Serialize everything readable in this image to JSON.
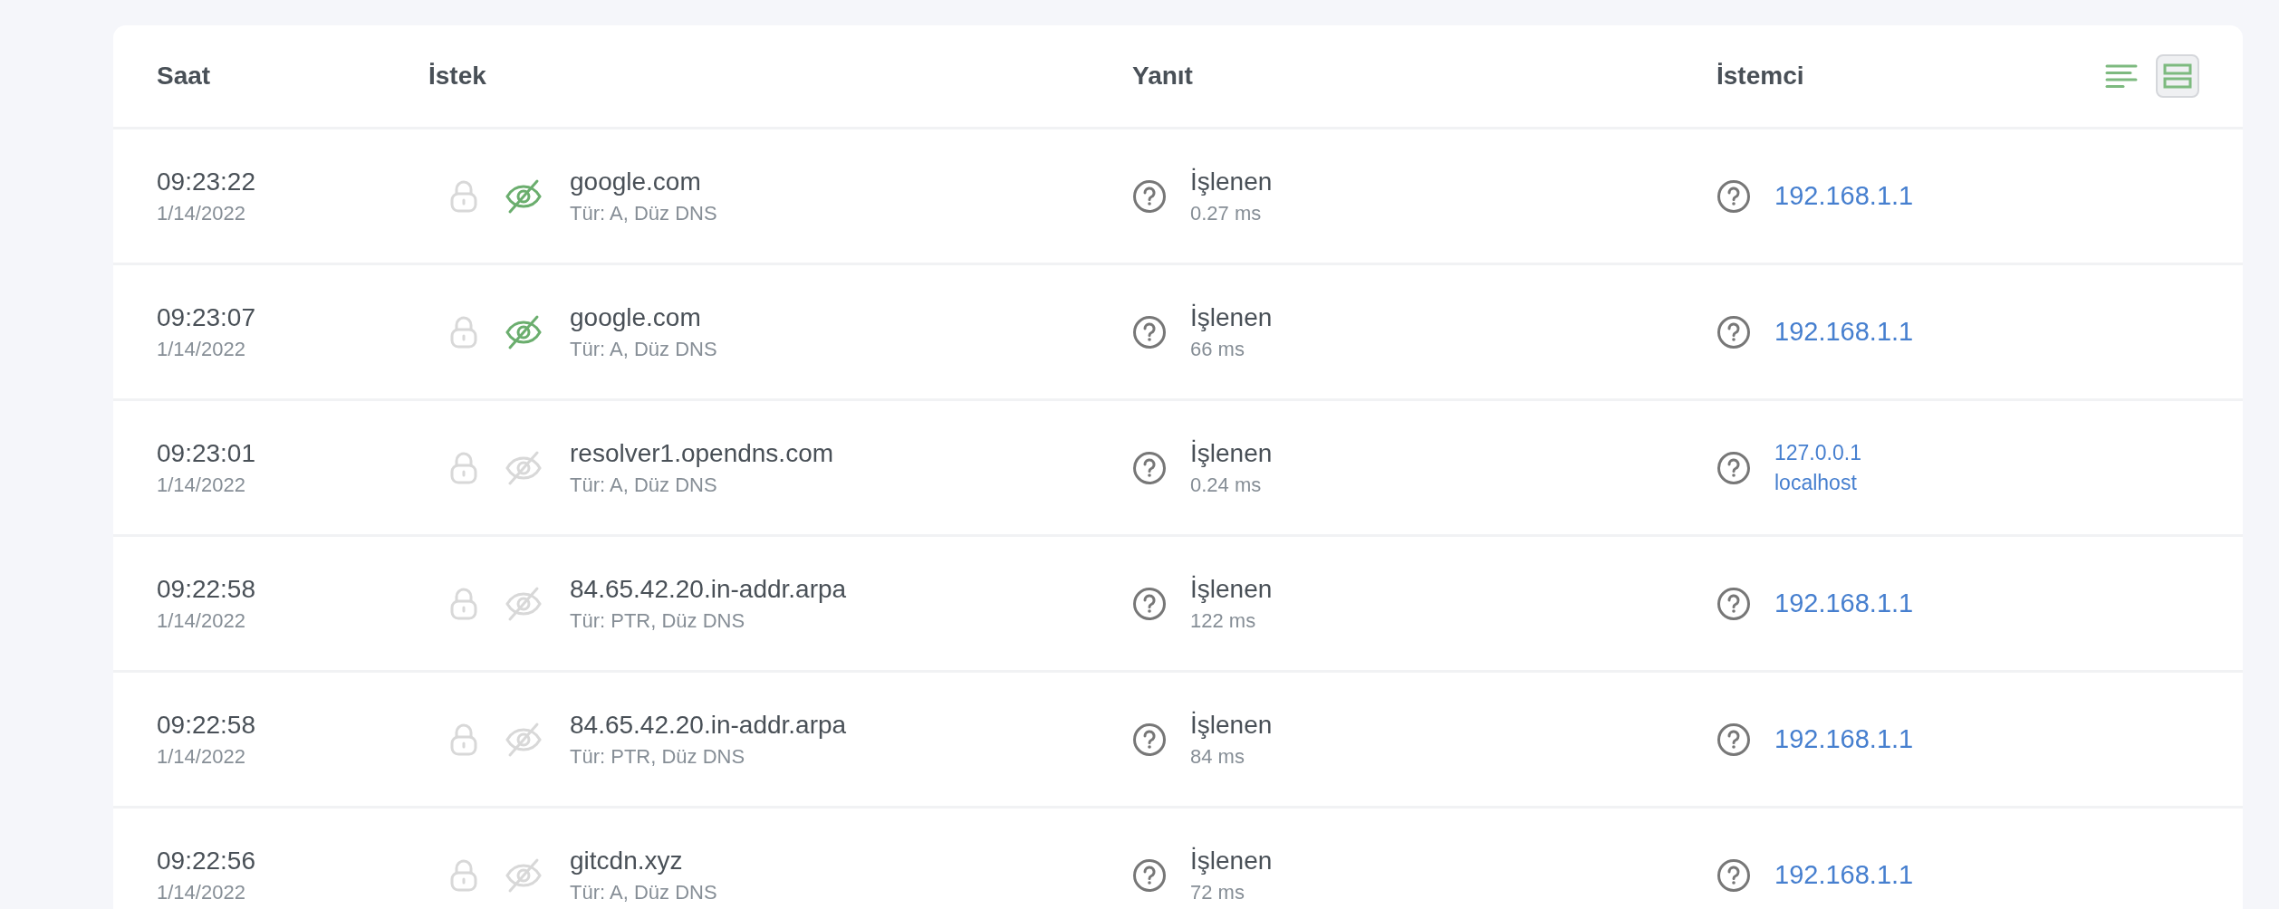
{
  "table": {
    "columns": [
      "Saat",
      "İstek",
      "Yanıt",
      "İstemci"
    ],
    "view_toggle": [
      {
        "kind": "compact",
        "selected": false
      },
      {
        "kind": "expanded",
        "selected": true
      }
    ],
    "rows": [
      {
        "time": "09:23:22",
        "date": "1/14/2022",
        "domain": "google.com",
        "type": "Tür: A, Düz DNS",
        "validated": true,
        "status": "İşlenen",
        "elapsed": "0.27 ms",
        "client": "192.168.1.1"
      },
      {
        "time": "09:23:07",
        "date": "1/14/2022",
        "domain": "google.com",
        "type": "Tür: A, Düz DNS",
        "validated": true,
        "status": "İşlenen",
        "elapsed": "66 ms",
        "client": "192.168.1.1"
      },
      {
        "time": "09:23:01",
        "date": "1/14/2022",
        "domain": "resolver1.opendns.com",
        "type": "Tür: A, Düz DNS",
        "validated": false,
        "status": "İşlenen",
        "elapsed": "0.24 ms",
        "client": "127.0.0.1",
        "client_name": "localhost"
      },
      {
        "time": "09:22:58",
        "date": "1/14/2022",
        "domain": "84.65.42.20.in-addr.arpa",
        "type": "Tür: PTR, Düz DNS",
        "validated": false,
        "status": "İşlenen",
        "elapsed": "122 ms",
        "client": "192.168.1.1"
      },
      {
        "time": "09:22:58",
        "date": "1/14/2022",
        "domain": "84.65.42.20.in-addr.arpa",
        "type": "Tür: PTR, Düz DNS",
        "validated": false,
        "status": "İşlenen",
        "elapsed": "84 ms",
        "client": "192.168.1.1"
      },
      {
        "time": "09:22:56",
        "date": "1/14/2022",
        "domain": "gitcdn.xyz",
        "type": "Tür: A, Düz DNS",
        "validated": false,
        "status": "İşlenen",
        "elapsed": "72 ms",
        "client": "192.168.1.1"
      }
    ]
  }
}
